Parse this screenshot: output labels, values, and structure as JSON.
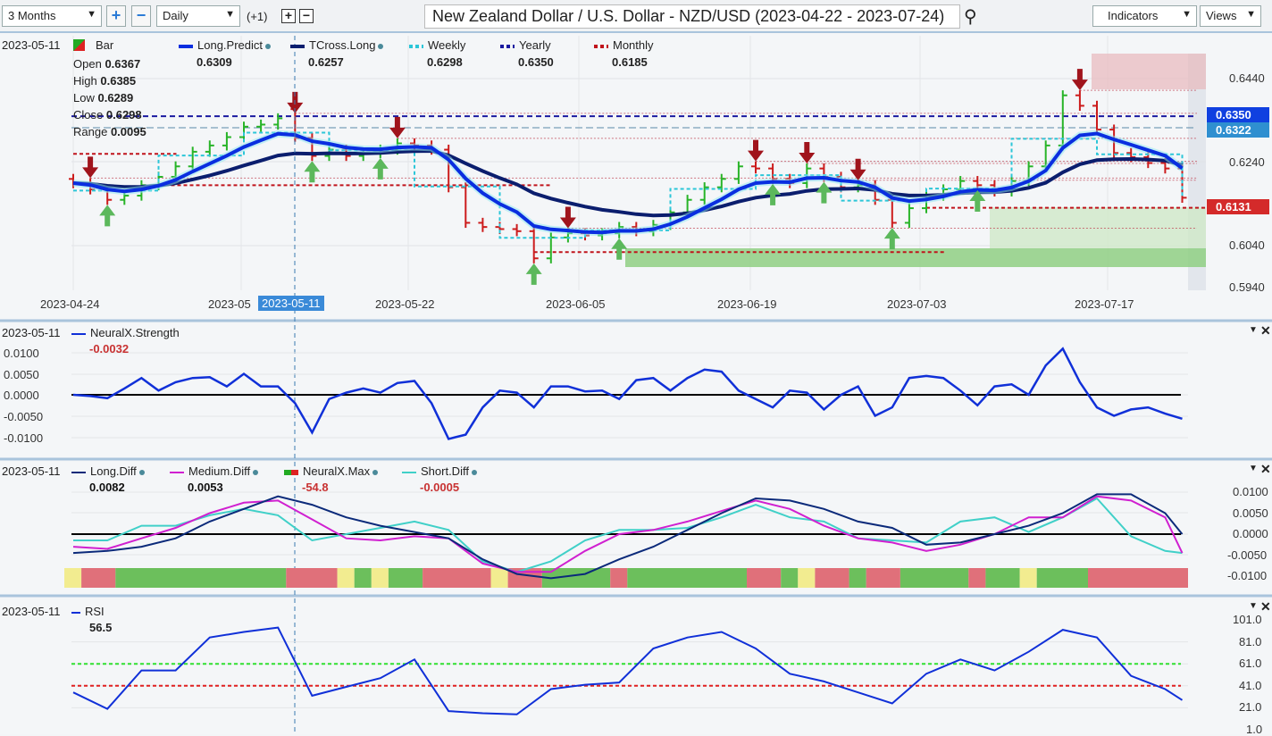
{
  "toolbar": {
    "range": "3 Months",
    "interval": "Daily",
    "offset": "(+1)",
    "title": "New Zealand Dollar / U.S. Dollar - NZD/USD (2023-04-22 - 2023-07-24)",
    "indicators": "Indicators",
    "views": "Views"
  },
  "crosshair_date": "2023-05-11",
  "main_legend": {
    "date": "2023-05-11",
    "bar": "Bar",
    "open_label": "Open",
    "open": "0.6367",
    "high_label": "High",
    "high": "0.6385",
    "low_label": "Low",
    "low": "0.6289",
    "close_label": "Close",
    "close": "0.6298",
    "range_label": "Range",
    "range": "0.0095",
    "series": [
      {
        "name": "Long.Predict",
        "value": "0.6309",
        "color": "#0a2ee0"
      },
      {
        "name": "TCross.Long",
        "value": "0.6257",
        "color": "#0b1e6e"
      },
      {
        "name": "Weekly",
        "value": "0.6298",
        "color": "#2cc6d8"
      },
      {
        "name": "Yearly",
        "value": "0.6350",
        "color": "#1a1aa0"
      },
      {
        "name": "Monthly",
        "value": "0.6185",
        "color": "#c0141c"
      }
    ]
  },
  "price_axis": [
    "0.6440",
    "0.6240",
    "0.6040",
    "0.5940"
  ],
  "price_tags": [
    {
      "value": "0.6350",
      "color": "#1040e0"
    },
    {
      "value": "0.6322",
      "color": "#2f8fd0"
    },
    {
      "value": "0.6131",
      "color": "#d42a2a"
    }
  ],
  "date_axis": [
    "2023-04-24",
    "2023-05",
    "2023-05-22",
    "2023-06-05",
    "2023-06-19",
    "2023-07-03",
    "2023-07-17"
  ],
  "strength": {
    "date": "2023-05-11",
    "name": "NeuralX.Strength",
    "value": "-0.0032",
    "axis": [
      "0.0100",
      "0.0050",
      "0.0000",
      "-0.0050",
      "-0.0100"
    ]
  },
  "diff": {
    "date": "2023-05-11",
    "series": [
      {
        "name": "Long.Diff",
        "value": "0.0082",
        "color": "#0b2a7a"
      },
      {
        "name": "Medium.Diff",
        "value": "0.0053",
        "color": "#d020d0"
      },
      {
        "name": "NeuralX.Max",
        "value": "-54.8",
        "color": "#d42a2a"
      },
      {
        "name": "Short.Diff",
        "value": "-0.0005",
        "color": "#40d0c8"
      }
    ],
    "axis": [
      "0.0100",
      "0.0050",
      "0.0000",
      "-0.0050",
      "-0.0100"
    ]
  },
  "rsi": {
    "date": "2023-05-11",
    "name": "RSI",
    "value": "56.5",
    "axis": [
      "101.0",
      "81.0",
      "61.0",
      "41.0",
      "21.0",
      "1.0"
    ]
  },
  "chart_data": {
    "type": "bar",
    "price_range": [
      0.594,
      0.646
    ],
    "closes": [
      0.619,
      0.6175,
      0.615,
      0.616,
      0.6185,
      0.6205,
      0.623,
      0.6265,
      0.628,
      0.63,
      0.6325,
      0.633,
      0.6345,
      0.6298,
      0.6255,
      0.627,
      0.6255,
      0.6262,
      0.627,
      0.6285,
      0.628,
      0.627,
      0.618,
      0.6095,
      0.6085,
      0.608,
      0.6075,
      0.601,
      0.606,
      0.607,
      0.6065,
      0.607,
      0.6085,
      0.6075,
      0.609,
      0.612,
      0.615,
      0.618,
      0.62,
      0.623,
      0.6225,
      0.62,
      0.619,
      0.6225,
      0.6205,
      0.618,
      0.6185,
      0.615,
      0.6095,
      0.613,
      0.616,
      0.6175,
      0.6195,
      0.6185,
      0.617,
      0.6195,
      0.623,
      0.628,
      0.64,
      0.6375,
      0.6318,
      0.6262,
      0.6252,
      0.6238,
      0.6225,
      0.6155
    ],
    "yearly": 0.635,
    "monthly": [
      {
        "month": "2023-04",
        "level": 0.626
      },
      {
        "month": "2023-05",
        "level": 0.6185
      },
      {
        "month": "2023-06",
        "level": 0.6025
      },
      {
        "month": "2023-07",
        "level": 0.6131
      }
    ],
    "sell_signals": [
      1,
      13,
      19,
      29,
      40,
      43,
      46,
      59
    ],
    "buy_signals": [
      2,
      14,
      18,
      27,
      32,
      41,
      44,
      48,
      53
    ],
    "strength": [
      0,
      -0.0003,
      -0.0008,
      0.0015,
      0.004,
      0.001,
      0.003,
      0.004,
      0.0042,
      0.002,
      0.005,
      0.002,
      0.002,
      -0.002,
      -0.009,
      -0.001,
      0.0005,
      0.0015,
      0.0005,
      0.0028,
      0.0033,
      -0.002,
      -0.0105,
      -0.0095,
      -0.003,
      0.001,
      0.0005,
      -0.003,
      0.002,
      0.002,
      0.0008,
      0.001,
      -0.001,
      0.0035,
      0.004,
      0.001,
      0.004,
      0.006,
      0.0055,
      0.001,
      -0.001,
      -0.003,
      0.001,
      0.0005,
      -0.0035,
      0,
      0.002,
      -0.005,
      -0.003,
      0.004,
      0.0045,
      0.004,
      0.001,
      -0.0025,
      0.002,
      0.0025,
      0,
      0.007,
      0.011,
      0.003,
      -0.003,
      -0.005,
      -0.0035,
      -0.003,
      -0.0045,
      -0.0057
    ],
    "long_diff": [
      -0.0045,
      -0.004,
      -0.003,
      -0.001,
      0.003,
      0.006,
      0.009,
      0.007,
      0.004,
      0.002,
      0.0005,
      -0.001,
      -0.006,
      -0.0095,
      -0.0105,
      -0.0095,
      -0.006,
      -0.003,
      0.001,
      0.005,
      0.0085,
      0.008,
      0.006,
      0.003,
      0.0015,
      -0.0025,
      -0.002,
      0.0,
      0.002,
      0.005,
      0.0095,
      0.0095,
      0.005,
      0.0
    ],
    "medium_diff": [
      -0.003,
      -0.0035,
      -0.001,
      0.0015,
      0.005,
      0.0075,
      0.008,
      0.0035,
      -0.001,
      -0.0015,
      -0.0005,
      -0.001,
      -0.007,
      -0.009,
      -0.009,
      -0.004,
      0.0,
      0.001,
      0.003,
      0.0055,
      0.008,
      0.006,
      0.002,
      -0.001,
      -0.002,
      -0.004,
      -0.0025,
      0.0,
      0.004,
      0.004,
      0.009,
      0.008,
      0.004,
      -0.0045
    ],
    "short_diff": [
      -0.0015,
      -0.0015,
      0.002,
      0.002,
      0.0045,
      0.006,
      0.0045,
      -0.0015,
      0.0,
      0.0015,
      0.003,
      0.001,
      -0.0065,
      -0.009,
      -0.0065,
      -0.0015,
      0.001,
      0.001,
      0.0015,
      0.004,
      0.007,
      0.004,
      0.003,
      -0.001,
      -0.0015,
      -0.002,
      0.003,
      0.004,
      0.0005,
      0.004,
      0.0085,
      -0.0005,
      -0.004,
      -0.0045
    ],
    "neuralx_max_runs": [
      [
        "yellow",
        1
      ],
      [
        "red",
        2
      ],
      [
        "green",
        10
      ],
      [
        "red",
        3
      ],
      [
        "yellow",
        1
      ],
      [
        "green",
        1
      ],
      [
        "yellow",
        1
      ],
      [
        "green",
        2
      ],
      [
        "red",
        4
      ],
      [
        "yellow",
        1
      ],
      [
        "red",
        2
      ],
      [
        "green",
        4
      ],
      [
        "red",
        1
      ],
      [
        "green",
        7
      ],
      [
        "red",
        2
      ],
      [
        "green",
        1
      ],
      [
        "yellow",
        1
      ],
      [
        "red",
        2
      ],
      [
        "green",
        1
      ],
      [
        "red",
        2
      ],
      [
        "green",
        4
      ],
      [
        "red",
        1
      ],
      [
        "green",
        2
      ],
      [
        "yellow",
        1
      ],
      [
        "green",
        3
      ],
      [
        "red",
        6
      ]
    ],
    "rsi": [
      35,
      20,
      55,
      55,
      85,
      90,
      94,
      32,
      40,
      48,
      65,
      18,
      16,
      15,
      38,
      42,
      44,
      75,
      85,
      90,
      75,
      52,
      45,
      35,
      25,
      52,
      65,
      55,
      72,
      92,
      85,
      50,
      38,
      28
    ],
    "rsi_levels": {
      "upper": 61,
      "lower": 41
    }
  }
}
